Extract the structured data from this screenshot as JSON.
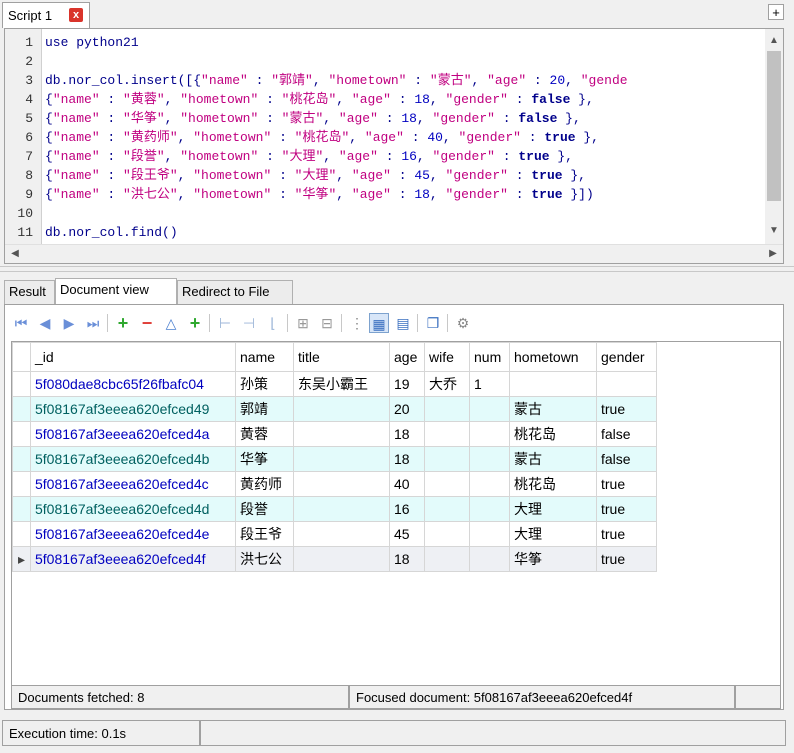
{
  "script_tab": {
    "label": "Script 1",
    "close": "x"
  },
  "add_tab": "+",
  "editor": {
    "line_numbers": [
      "1",
      "2",
      "3",
      "4",
      "5",
      "6",
      "7",
      "8",
      "9",
      "10",
      "11"
    ],
    "lines": [
      [
        {
          "t": "use python21",
          "c": "kw"
        }
      ],
      [],
      [
        {
          "t": "db.",
          "c": "kw"
        },
        {
          "t": "nor_col",
          "c": "kw"
        },
        {
          "t": ".insert([{",
          "c": "kw"
        },
        {
          "t": "\"name\"",
          "c": "str"
        },
        {
          "t": " : ",
          "c": "kw"
        },
        {
          "t": "\"郭靖\"",
          "c": "str"
        },
        {
          "t": ", ",
          "c": "kw"
        },
        {
          "t": "\"hometown\"",
          "c": "str"
        },
        {
          "t": " : ",
          "c": "kw"
        },
        {
          "t": "\"蒙古\"",
          "c": "str"
        },
        {
          "t": ", ",
          "c": "kw"
        },
        {
          "t": "\"age\"",
          "c": "str"
        },
        {
          "t": " : ",
          "c": "kw"
        },
        {
          "t": "20",
          "c": "num"
        },
        {
          "t": ", ",
          "c": "kw"
        },
        {
          "t": "\"gende",
          "c": "str"
        }
      ],
      [
        {
          "t": "{",
          "c": "kw"
        },
        {
          "t": "\"name\"",
          "c": "str"
        },
        {
          "t": " : ",
          "c": "kw"
        },
        {
          "t": "\"黄蓉\"",
          "c": "str"
        },
        {
          "t": ", ",
          "c": "kw"
        },
        {
          "t": "\"hometown\"",
          "c": "str"
        },
        {
          "t": " : ",
          "c": "kw"
        },
        {
          "t": "\"桃花岛\"",
          "c": "str"
        },
        {
          "t": ", ",
          "c": "kw"
        },
        {
          "t": "\"age\"",
          "c": "str"
        },
        {
          "t": " : ",
          "c": "kw"
        },
        {
          "t": "18",
          "c": "num"
        },
        {
          "t": ", ",
          "c": "kw"
        },
        {
          "t": "\"gender\"",
          "c": "str"
        },
        {
          "t": " : ",
          "c": "kw"
        },
        {
          "t": "false",
          "c": "boolv"
        },
        {
          "t": " },",
          "c": "kw"
        }
      ],
      [
        {
          "t": "{",
          "c": "kw"
        },
        {
          "t": "\"name\"",
          "c": "str"
        },
        {
          "t": " : ",
          "c": "kw"
        },
        {
          "t": "\"华筝\"",
          "c": "str"
        },
        {
          "t": ", ",
          "c": "kw"
        },
        {
          "t": "\"hometown\"",
          "c": "str"
        },
        {
          "t": " : ",
          "c": "kw"
        },
        {
          "t": "\"蒙古\"",
          "c": "str"
        },
        {
          "t": ", ",
          "c": "kw"
        },
        {
          "t": "\"age\"",
          "c": "str"
        },
        {
          "t": " : ",
          "c": "kw"
        },
        {
          "t": "18",
          "c": "num"
        },
        {
          "t": ", ",
          "c": "kw"
        },
        {
          "t": "\"gender\"",
          "c": "str"
        },
        {
          "t": " : ",
          "c": "kw"
        },
        {
          "t": "false",
          "c": "boolv"
        },
        {
          "t": " },",
          "c": "kw"
        }
      ],
      [
        {
          "t": "{",
          "c": "kw"
        },
        {
          "t": "\"name\"",
          "c": "str"
        },
        {
          "t": " : ",
          "c": "kw"
        },
        {
          "t": "\"黄药师\"",
          "c": "str"
        },
        {
          "t": ", ",
          "c": "kw"
        },
        {
          "t": "\"hometown\"",
          "c": "str"
        },
        {
          "t": " : ",
          "c": "kw"
        },
        {
          "t": "\"桃花岛\"",
          "c": "str"
        },
        {
          "t": ", ",
          "c": "kw"
        },
        {
          "t": "\"age\"",
          "c": "str"
        },
        {
          "t": " : ",
          "c": "kw"
        },
        {
          "t": "40",
          "c": "num"
        },
        {
          "t": ", ",
          "c": "kw"
        },
        {
          "t": "\"gender\"",
          "c": "str"
        },
        {
          "t": " : ",
          "c": "kw"
        },
        {
          "t": "true",
          "c": "boolv"
        },
        {
          "t": " },",
          "c": "kw"
        }
      ],
      [
        {
          "t": "{",
          "c": "kw"
        },
        {
          "t": "\"name\"",
          "c": "str"
        },
        {
          "t": " : ",
          "c": "kw"
        },
        {
          "t": "\"段誉\"",
          "c": "str"
        },
        {
          "t": ", ",
          "c": "kw"
        },
        {
          "t": "\"hometown\"",
          "c": "str"
        },
        {
          "t": " : ",
          "c": "kw"
        },
        {
          "t": "\"大理\"",
          "c": "str"
        },
        {
          "t": ", ",
          "c": "kw"
        },
        {
          "t": "\"age\"",
          "c": "str"
        },
        {
          "t": " : ",
          "c": "kw"
        },
        {
          "t": "16",
          "c": "num"
        },
        {
          "t": ", ",
          "c": "kw"
        },
        {
          "t": "\"gender\"",
          "c": "str"
        },
        {
          "t": " : ",
          "c": "kw"
        },
        {
          "t": "true",
          "c": "boolv"
        },
        {
          "t": " },",
          "c": "kw"
        }
      ],
      [
        {
          "t": "{",
          "c": "kw"
        },
        {
          "t": "\"name\"",
          "c": "str"
        },
        {
          "t": " : ",
          "c": "kw"
        },
        {
          "t": "\"段王爷\"",
          "c": "str"
        },
        {
          "t": ", ",
          "c": "kw"
        },
        {
          "t": "\"hometown\"",
          "c": "str"
        },
        {
          "t": " : ",
          "c": "kw"
        },
        {
          "t": "\"大理\"",
          "c": "str"
        },
        {
          "t": ", ",
          "c": "kw"
        },
        {
          "t": "\"age\"",
          "c": "str"
        },
        {
          "t": " : ",
          "c": "kw"
        },
        {
          "t": "45",
          "c": "num"
        },
        {
          "t": ", ",
          "c": "kw"
        },
        {
          "t": "\"gender\"",
          "c": "str"
        },
        {
          "t": " : ",
          "c": "kw"
        },
        {
          "t": "true",
          "c": "boolv"
        },
        {
          "t": " },",
          "c": "kw"
        }
      ],
      [
        {
          "t": "{",
          "c": "kw"
        },
        {
          "t": "\"name\"",
          "c": "str"
        },
        {
          "t": " : ",
          "c": "kw"
        },
        {
          "t": "\"洪七公\"",
          "c": "str"
        },
        {
          "t": ", ",
          "c": "kw"
        },
        {
          "t": "\"hometown\"",
          "c": "str"
        },
        {
          "t": " : ",
          "c": "kw"
        },
        {
          "t": "\"华筝\"",
          "c": "str"
        },
        {
          "t": ", ",
          "c": "kw"
        },
        {
          "t": "\"age\"",
          "c": "str"
        },
        {
          "t": " : ",
          "c": "kw"
        },
        {
          "t": "18",
          "c": "num"
        },
        {
          "t": ", ",
          "c": "kw"
        },
        {
          "t": "\"gender\"",
          "c": "str"
        },
        {
          "t": " : ",
          "c": "kw"
        },
        {
          "t": "true",
          "c": "boolv"
        },
        {
          "t": " }])",
          "c": "kw"
        }
      ],
      [],
      [
        {
          "t": "db.",
          "c": "kw"
        },
        {
          "t": "nor_col",
          "c": "kw"
        },
        {
          "t": ".find()",
          "c": "kw"
        }
      ]
    ]
  },
  "result_tabs": [
    "Result",
    "Document view",
    "Redirect to File"
  ],
  "active_result_tab": "Document view",
  "toolbar_icons": [
    "first-icon",
    "prev-icon",
    "next-icon",
    "last-icon",
    "add-icon",
    "remove-icon",
    "up-icon",
    "add-two-icon",
    "add-field-icon",
    "remove-field-icon",
    "edit-field-icon",
    "expand-icon",
    "collapse-icon",
    "tree-view-icon",
    "grid-view-icon",
    "text-view-icon",
    "copy-icon",
    "settings-icon"
  ],
  "table": {
    "columns": [
      "_id",
      "name",
      "title",
      "age",
      "wife",
      "num",
      "hometown",
      "gender"
    ],
    "rows": [
      [
        "5f080dae8cbc65f26fbafc04",
        "孙策",
        "东吴小霸王",
        "19",
        "大乔",
        "1",
        "",
        ""
      ],
      [
        "5f08167af3eeea620efced49",
        "郭靖",
        "",
        "20",
        "",
        "",
        "蒙古",
        "true"
      ],
      [
        "5f08167af3eeea620efced4a",
        "黄蓉",
        "",
        "18",
        "",
        "",
        "桃花岛",
        "false"
      ],
      [
        "5f08167af3eeea620efced4b",
        "华筝",
        "",
        "18",
        "",
        "",
        "蒙古",
        "false"
      ],
      [
        "5f08167af3eeea620efced4c",
        "黄药师",
        "",
        "40",
        "",
        "",
        "桃花岛",
        "true"
      ],
      [
        "5f08167af3eeea620efced4d",
        "段誉",
        "",
        "16",
        "",
        "",
        "大理",
        "true"
      ],
      [
        "5f08167af3eeea620efced4e",
        "段王爷",
        "",
        "45",
        "",
        "",
        "大理",
        "true"
      ],
      [
        "5f08167af3eeea620efced4f",
        "洪七公",
        "",
        "18",
        "",
        "",
        "华筝",
        "true"
      ]
    ],
    "selected_row": 7,
    "row_indicator": "▸"
  },
  "status": {
    "fetched": "Documents fetched: 8",
    "focused": "Focused document: 5f08167af3eeea620efced4f"
  },
  "footer": {
    "execution": "Execution time: 0.1s"
  },
  "colors": {
    "alt_row": "#e3fbfb",
    "close_tab": "#d9342b",
    "keyword": "#00008b",
    "string": "#c00080"
  }
}
